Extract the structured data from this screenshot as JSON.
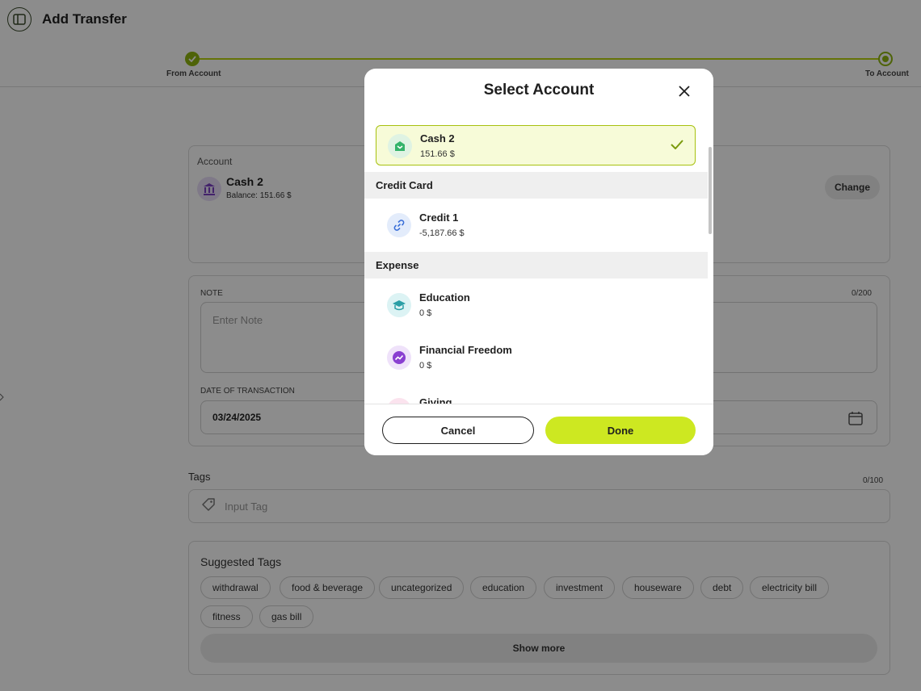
{
  "header": {
    "title": "Add Transfer"
  },
  "stepper": {
    "from_label": "From Account",
    "to_label": "To Account"
  },
  "account_card": {
    "label": "Account",
    "name": "Cash 2",
    "balance": "Balance: 151.66 $",
    "change_label": "Change"
  },
  "note": {
    "label": "NOTE",
    "placeholder": "Enter Note",
    "count": "0/200"
  },
  "date": {
    "label": "DATE OF TRANSACTION",
    "value": "03/24/2025"
  },
  "tags": {
    "title": "Tags",
    "count": "0/100",
    "placeholder": "Input Tag"
  },
  "suggested": {
    "title": "Suggested Tags",
    "chips": [
      "withdrawal",
      "food & beverage",
      "uncategorized",
      "education",
      "investment",
      "houseware",
      "debt",
      "electricity bill",
      "fitness",
      "gas bill"
    ],
    "show_more": "Show more"
  },
  "modal": {
    "title": "Select Account",
    "items": [
      {
        "name": "Cash 2",
        "value": "151.66 $",
        "icon": "wallet-icon",
        "selected": true
      },
      {
        "name": "Credit 1",
        "value": "-5,187.66 $",
        "icon": "link-icon"
      },
      {
        "name": "Education",
        "value": "0 $",
        "icon": "graduation-cap-icon"
      },
      {
        "name": "Financial Freedom",
        "value": "0 $",
        "icon": "trend-up-icon"
      },
      {
        "name": "Giving",
        "value": "",
        "icon": "gift-icon"
      }
    ],
    "sections": [
      "Credit Card",
      "Expense"
    ],
    "cancel_label": "Cancel",
    "done_label": "Done"
  },
  "colors": {
    "accent": "#cde821",
    "accent_dark": "#8fb50f",
    "selected_bg": "#f7fbd8"
  }
}
